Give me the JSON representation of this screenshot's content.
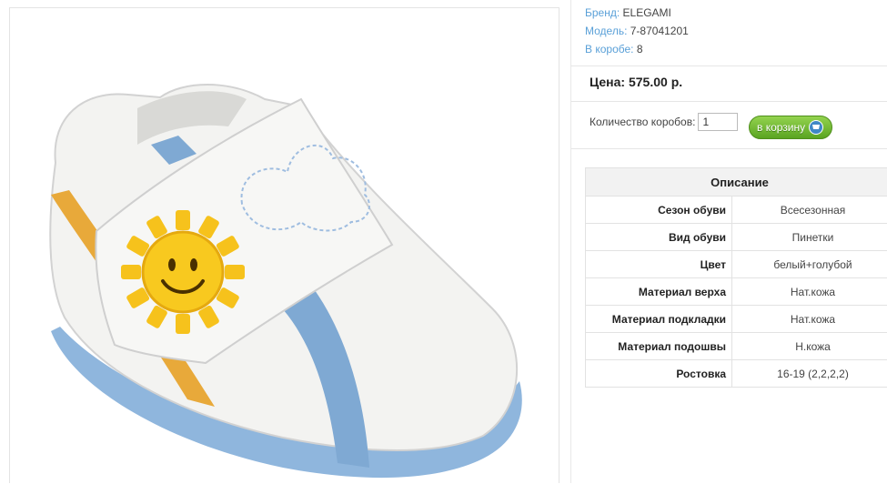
{
  "product": {
    "brand_label": "Бренд:",
    "brand": "ELEGAMI",
    "model_label": "Модель:",
    "model": "7-87041201",
    "box_label": "В коробе:",
    "box": "8",
    "price": "Цена: 575.00 р.",
    "qty_label": "Количество коробов:",
    "qty_value": "1",
    "cart_label": "в корзину"
  },
  "description": {
    "title": "Описание",
    "rows": [
      {
        "key": "Сезон обуви",
        "value": "Всесезонная"
      },
      {
        "key": "Вид обуви",
        "value": "Пинетки"
      },
      {
        "key": "Цвет",
        "value": "белый+голубой"
      },
      {
        "key": "Материал верха",
        "value": "Нат.кожа"
      },
      {
        "key": "Материал подкладки",
        "value": "Нат.кожа"
      },
      {
        "key": "Материал подошвы",
        "value": "Н.кожа"
      },
      {
        "key": "Ростовка",
        "value": "16-19 (2,2,2,2)"
      }
    ]
  },
  "colors": {
    "label_blue": "#5aa0d8",
    "button_green": "#6bb12a",
    "shoe_blue": "#7fa9d3",
    "shoe_yellow": "#e8a93a"
  }
}
